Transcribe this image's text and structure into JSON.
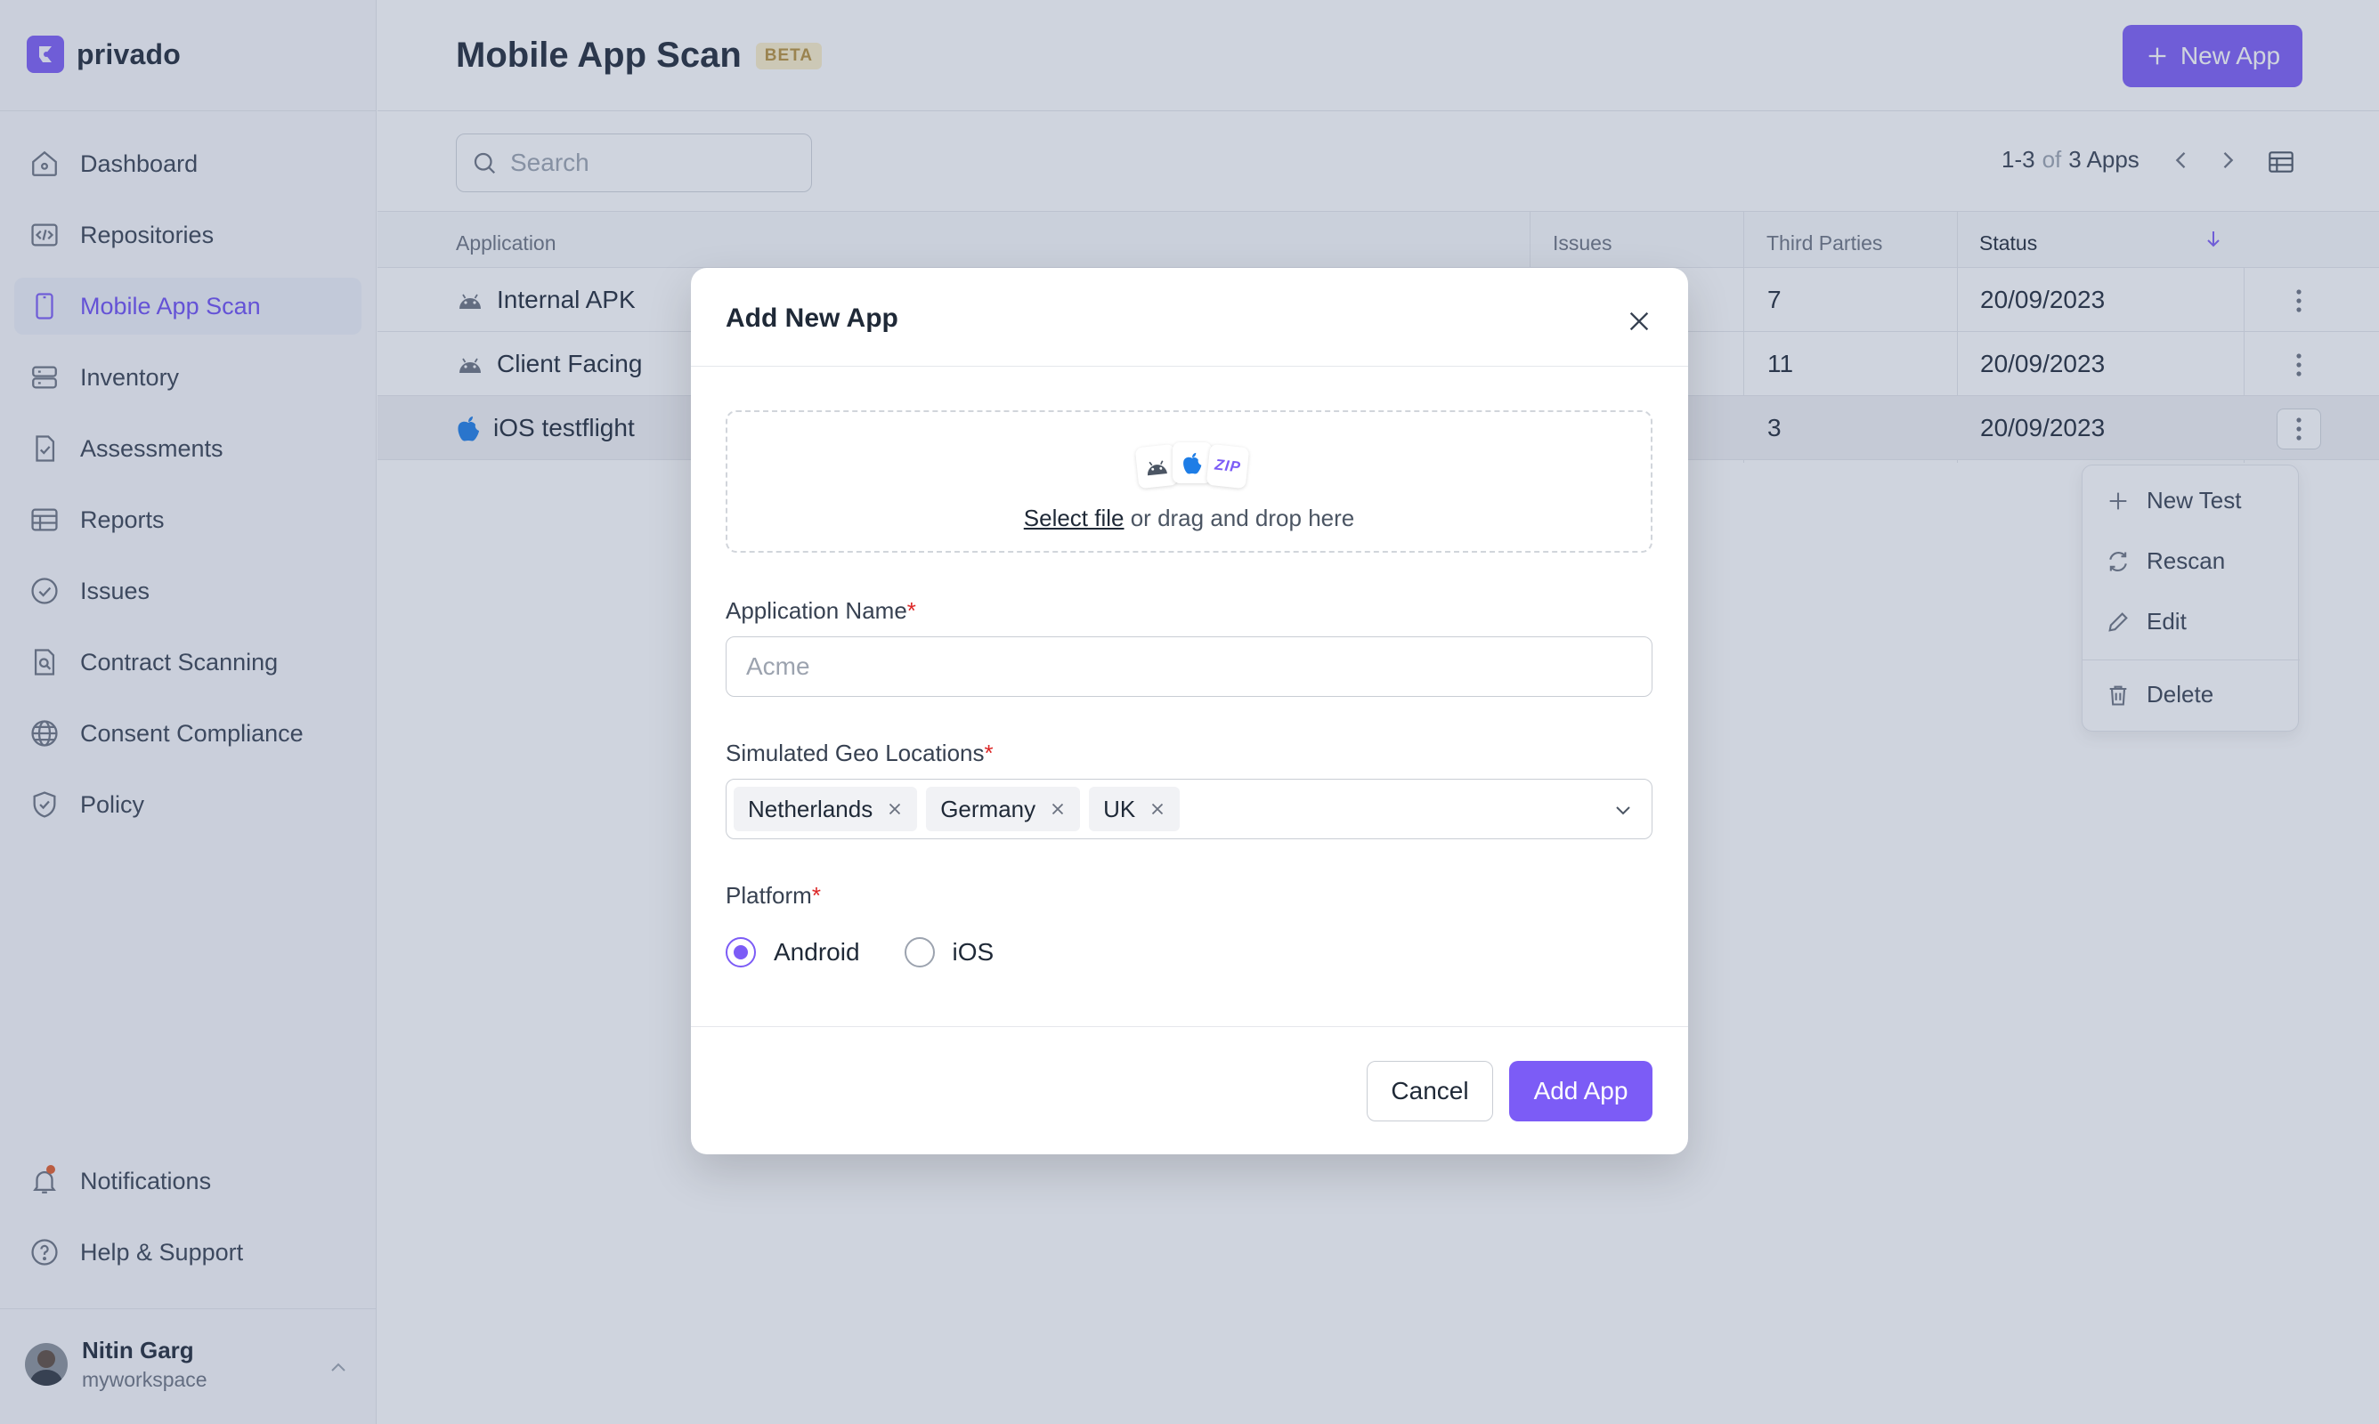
{
  "brand": {
    "name": "privado",
    "accent": "#7c5cf6"
  },
  "sidebar": {
    "items": [
      {
        "label": "Dashboard",
        "icon": "home-icon"
      },
      {
        "label": "Repositories",
        "icon": "code-icon"
      },
      {
        "label": "Mobile App Scan",
        "icon": "mobile-icon",
        "active": true
      },
      {
        "label": "Inventory",
        "icon": "server-icon"
      },
      {
        "label": "Assessments",
        "icon": "document-check-icon"
      },
      {
        "label": "Reports",
        "icon": "table-icon"
      },
      {
        "label": "Issues",
        "icon": "check-circle-icon"
      },
      {
        "label": "Contract Scanning",
        "icon": "document-search-icon"
      },
      {
        "label": "Consent Compliance",
        "icon": "globe-icon"
      },
      {
        "label": "Policy",
        "icon": "shield-check-icon"
      }
    ],
    "bottom_items": [
      {
        "label": "Notifications",
        "icon": "bell-icon"
      },
      {
        "label": "Help & Support",
        "icon": "help-circle-icon"
      }
    ],
    "user": {
      "name": "Nitin Garg",
      "workspace": "myworkspace"
    }
  },
  "header": {
    "title": "Mobile App Scan",
    "badge": "BETA",
    "new_app_label": "New App"
  },
  "toolbar": {
    "search_placeholder": "Search",
    "pager_range": "1-3",
    "pager_of": "of",
    "pager_total": "3 Apps"
  },
  "table": {
    "columns": [
      "Application",
      "Issues",
      "Third Parties",
      "Status"
    ],
    "rows": [
      {
        "name": "Internal APK",
        "platform": "android",
        "third_parties": "7",
        "status": "20/09/2023"
      },
      {
        "name": "Client Facing",
        "platform": "android",
        "third_parties": "11",
        "status": "20/09/2023"
      },
      {
        "name": "iOS testflight",
        "platform": "ios",
        "third_parties": "3",
        "status": "20/09/2023"
      }
    ]
  },
  "context_menu": {
    "items": [
      {
        "label": "New Test",
        "icon": "plus-icon"
      },
      {
        "label": "Rescan",
        "icon": "refresh-icon"
      },
      {
        "label": "Edit",
        "icon": "pencil-icon"
      },
      {
        "label": "Delete",
        "icon": "trash-icon"
      }
    ]
  },
  "modal": {
    "title": "Add New App",
    "dropzone": {
      "link": "Select file",
      "text": " or drag and drop here",
      "zip_label": "ZIP"
    },
    "app_name": {
      "label": "Application Name",
      "required_mark": "*",
      "placeholder": "Acme"
    },
    "geo": {
      "label": "Simulated Geo Locations",
      "required_mark": "*",
      "tags": [
        "Netherlands",
        "Germany",
        "UK"
      ]
    },
    "platform": {
      "label": "Platform",
      "required_mark": "*",
      "options": [
        "Android",
        "iOS"
      ],
      "selected": "Android"
    },
    "cancel_label": "Cancel",
    "submit_label": "Add App"
  }
}
